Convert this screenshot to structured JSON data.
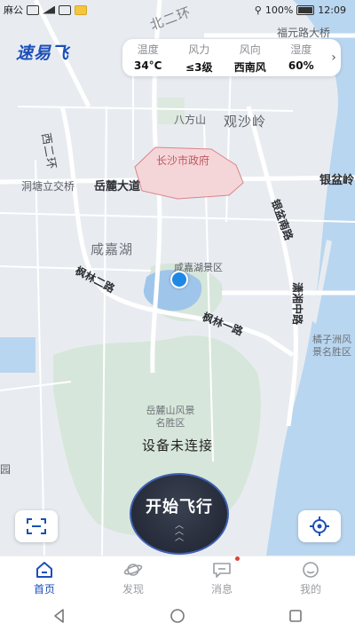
{
  "status_bar": {
    "left_text": "麻公",
    "battery": "100%",
    "time": "12:09"
  },
  "app": {
    "logo": "速易飞"
  },
  "weather": {
    "items": [
      {
        "label": "温度",
        "value": "34°C"
      },
      {
        "label": "风力",
        "value": "≤3级"
      },
      {
        "label": "风向",
        "value": "西南风"
      },
      {
        "label": "湿度",
        "value": "60%"
      }
    ],
    "more_icon": "chevron-right-icon"
  },
  "map": {
    "labels": {
      "north_ring": "北二环",
      "fuyuan": "福元路大桥",
      "bafang": "八方山",
      "guansha": "观沙岭",
      "west_ring": "西二环",
      "gov": "长沙市政府",
      "yinpen": "银盆岭",
      "runtang": "洞塘立交桥",
      "yuelu_blvd": "岳麓大道",
      "yinpen_south": "银盆南路",
      "xianjia_lake": "咸嘉湖",
      "xianjia_scenic": "咸嘉湖景区",
      "fenglin_2": "枫林二路",
      "fenglin_1": "枫林一路",
      "xiaoxiang": "潇湘中路",
      "juzizhou": "橘子洲风景名胜区",
      "yuelu_mountain": "岳麓山风景名胜区",
      "edge_left": "园"
    }
  },
  "connection_status": "设备未连接",
  "start_button": {
    "label": "开始飞行"
  },
  "nav": {
    "items": [
      {
        "label": "首页",
        "icon": "home-icon"
      },
      {
        "label": "发现",
        "icon": "planet-icon"
      },
      {
        "label": "消息",
        "icon": "message-icon"
      },
      {
        "label": "我的",
        "icon": "profile-icon"
      }
    ]
  },
  "colors": {
    "accent": "#1b4fb9",
    "start_bg": "#1d2230",
    "start_ring": "#3f5fb3",
    "gov_area": "#f5d6d8"
  }
}
